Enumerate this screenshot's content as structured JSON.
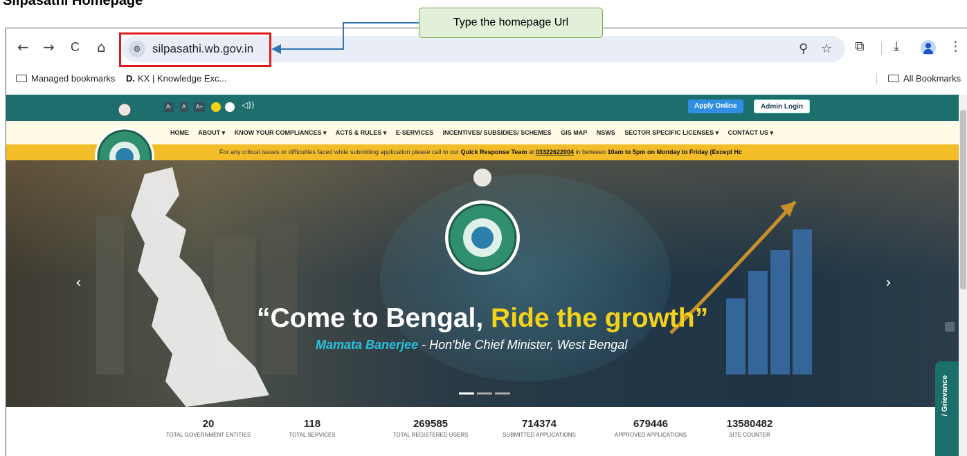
{
  "doc_title": "Silpasathi Homepage",
  "callout": {
    "text": "Type the homepage Url"
  },
  "browser": {
    "url": "silpasathi.wb.gov.in",
    "nav": {
      "back": "←",
      "forward": "→",
      "reload": "C",
      "home": "⌂"
    },
    "bookmarks": {
      "managed": "Managed bookmarks",
      "kx_prefix": "D.",
      "kx": "KX | Knowledge Exc...",
      "all": "All Bookmarks"
    },
    "icons": [
      "site-info-icon",
      "zoom-icon",
      "star-icon",
      "extensions-icon",
      "download-icon",
      "profile-avatar",
      "more-menu-icon"
    ]
  },
  "site": {
    "accessibility": {
      "decrease": "A-",
      "normal": "A",
      "increase": "A+"
    },
    "colors": {
      "theme_teal": "#1c6f6d",
      "yellow_dot": "#f5d21a",
      "ticker": "#f3bd2a",
      "apply_btn": "#2f8ee2"
    },
    "top_buttons": {
      "apply": "Apply Online",
      "admin": "Admin Login"
    },
    "menu": [
      "HOME",
      "ABOUT ▾",
      "KNOW YOUR COMPLIANCES ▾",
      "ACTS & RULES ▾",
      "E-SERVICES",
      "INCENTIVES/ SUBSIDIES/ SCHEMES",
      "GIS MAP",
      "NSWS",
      "SECTOR SPECIFIC LICENSES ▾",
      "CONTACT US ▾"
    ],
    "ticker": {
      "pre": "For any critical issues or difficulties faced while submitting application please call to our ",
      "team": "Quick Response Team",
      "mid": " at ",
      "phone": "03322622004",
      "mid2": " in between ",
      "hours": "10am to 5pm on Monday to Friday (Except Hc"
    },
    "hero": {
      "quote_open": "“Come to Bengal, ",
      "quote_highlight": "Ride the growth”",
      "name": "Mamata Banerjee",
      "sub": " - Hon'ble Chief Minister, West Bengal",
      "prev": "‹",
      "next": "›"
    },
    "stats": [
      {
        "value": "20",
        "label": "TOTAL GOVERNMENT ENTITIES"
      },
      {
        "value": "118",
        "label": "TOTAL SERVICES"
      },
      {
        "value": "269585",
        "label": "TOTAL REGISTERED USERS"
      },
      {
        "value": "714374",
        "label": "SUBMITTED APPLICATIONS"
      },
      {
        "value": "679446",
        "label": "APPROVED APPLICATIONS"
      },
      {
        "value": "13580482",
        "label": "SITE COUNTER"
      }
    ],
    "grievance": "/ Grievance"
  }
}
